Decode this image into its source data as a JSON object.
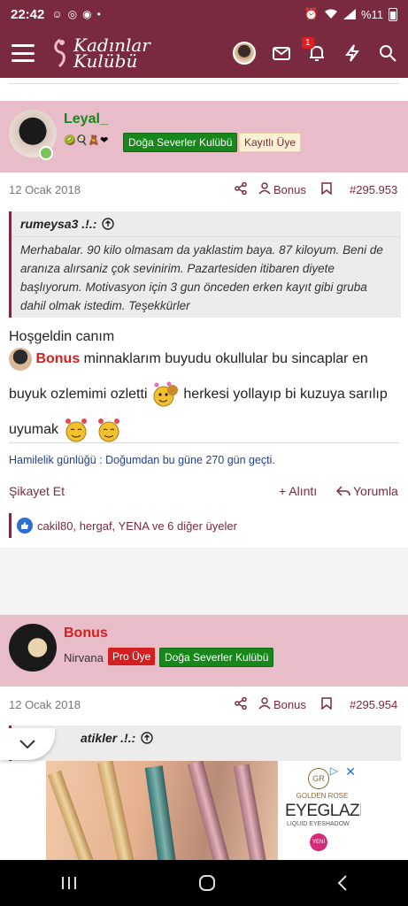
{
  "status_bar": {
    "time": "22:42",
    "battery": "%11"
  },
  "app": {
    "logo_line1": "Kadınlar",
    "logo_line2": "Kulübü",
    "notification_count": "1"
  },
  "posts": [
    {
      "author": "Leyal_",
      "badges_emoji": "🥝🍳🧸❤",
      "tags": [
        "Doğa Severler Kulübü",
        "Kayıtlı Üye"
      ],
      "date": "12 Ocak 2018",
      "bonus_label": "Bonus",
      "post_number": "#295.953",
      "quote_author": "rumeysa3 .!.:",
      "quote_text": "Merhabalar. 90 kilo olmasam da yaklastim baya. 87 kiloyum. Beni de aranıza alırsaniz çok sevinirim. Pazartesiden itibaren diyete başlıyorum. Motivasyon için 3 gun önceden erken kayıt gibi gruba dahil olmak istedim. Teşekkürler",
      "message_line1": "Hoşgeldin canım",
      "message_mention": "Bonus",
      "message_part2": " minnaklarım buyudu okullular bu sincaplar en buyuk ozlemimi ozletti ",
      "message_part3": " herkesi yollayıp bi kuzuya sarılıp uyumak ",
      "signature": "Hamilelik günlüğü : Doğumdan bu güne 270 gün geçti.",
      "report_label": "Şikayet Et",
      "quote_label": "+ Alıntı",
      "reply_label": "Yorumla",
      "likes_text": "cakil80, hergaf, YENA ve 6 diğer üyeler"
    },
    {
      "author": "Bonus",
      "subtitle": "Nirvana",
      "tags": [
        "Pro Üye",
        "Doğa Severler Kulübü"
      ],
      "date": "12 Ocak 2018",
      "bonus_label": "Bonus",
      "post_number": "#295.954",
      "quote_author": "atikler .!.:"
    }
  ],
  "ad": {
    "brand": "GOLDEN ROSE",
    "title": "EYEGLAZE",
    "subtitle": "LIQUID EYESHADOW",
    "badge": "YENİ"
  },
  "colors": {
    "brand": "#7a2a3f",
    "header_pink": "#e8bcc8",
    "green_tag": "#17861b",
    "red_tag": "#d31f1f"
  }
}
